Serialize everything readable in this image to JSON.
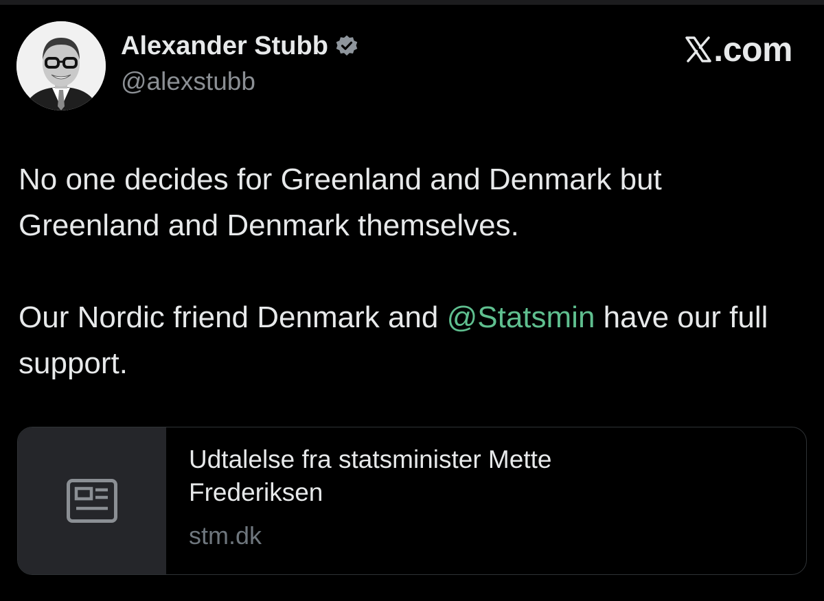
{
  "author": {
    "name": "Alexander Stubb",
    "handle": "@alexstubb",
    "verified_icon": "verified-badge"
  },
  "brand": {
    "label": "X.com",
    "icon": "x-logo"
  },
  "tweet": {
    "paragraph1": "No one decides for Greenland and Denmark but Greenland and Denmark themselves.",
    "paragraph2_before": "Our Nordic friend Denmark and ",
    "mention": "@Statsmin",
    "paragraph2_after": " have our full support."
  },
  "link_card": {
    "title": "Udtalelse fra statsminister Mette Frederiksen",
    "domain": "stm.dk",
    "thumbnail_icon": "article-icon"
  },
  "colors": {
    "background": "#000000",
    "text_primary": "#e7e9ea",
    "text_secondary": "#8b8f94",
    "mention": "#5fbf8f",
    "card_border": "#2f3336",
    "card_thumb_bg": "#25262a"
  }
}
